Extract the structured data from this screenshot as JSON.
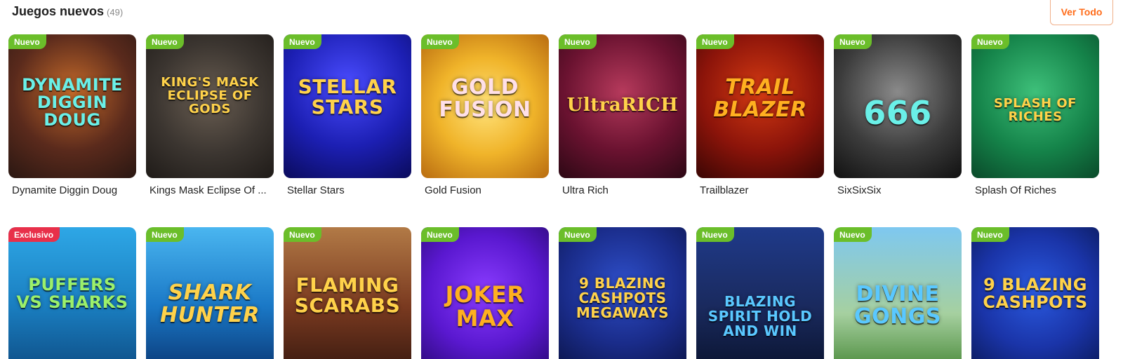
{
  "header": {
    "title": "Juegos nuevos",
    "count": "(49)",
    "view_all_label": "Ver Todo"
  },
  "colors": {
    "accent": "#ff6c1a",
    "badge_new": "#6bbe2a",
    "badge_exclusive": "#e8304a"
  },
  "games_row1": [
    {
      "badge": "Nuevo",
      "caption": "Dynamite Diggin Doug",
      "logo": "DYNAMITE DIGGIN DOUG"
    },
    {
      "badge": "Nuevo",
      "caption": "Kings Mask Eclipse Of ...",
      "logo": "KING'S MASK ECLIPSE OF GODS"
    },
    {
      "badge": "Nuevo",
      "caption": "Stellar Stars",
      "logo": "STELLAR STARS"
    },
    {
      "badge": "Nuevo",
      "caption": "Gold Fusion",
      "logo": "GOLD FUSION"
    },
    {
      "badge": "Nuevo",
      "caption": "Ultra Rich",
      "logo": "UltraRICH"
    },
    {
      "badge": "Nuevo",
      "caption": "Trailblazer",
      "logo": "TRAIL BLAZER"
    },
    {
      "badge": "Nuevo",
      "caption": "SixSixSix",
      "logo": "666"
    },
    {
      "badge": "Nuevo",
      "caption": "Splash Of Riches",
      "logo": "SPLASH OF RICHES"
    }
  ],
  "games_row2": [
    {
      "badge": "Exclusivo",
      "logo": "PUFFERS VS SHARKS"
    },
    {
      "badge": "Nuevo",
      "logo": "SHARK HUNTER"
    },
    {
      "badge": "Nuevo",
      "logo": "FLAMING SCARABS"
    },
    {
      "badge": "Nuevo",
      "logo": "JOKER MAX"
    },
    {
      "badge": "Nuevo",
      "logo": "9 BLAZING CASHPOTS MEGAWAYS"
    },
    {
      "badge": "Nuevo",
      "logo": "BLAZING SPIRIT HOLD AND WIN"
    },
    {
      "badge": "Nuevo",
      "logo": "DIVINE GONGS"
    },
    {
      "badge": "Nuevo",
      "logo": "9 BLAZING CASHPOTS"
    }
  ]
}
